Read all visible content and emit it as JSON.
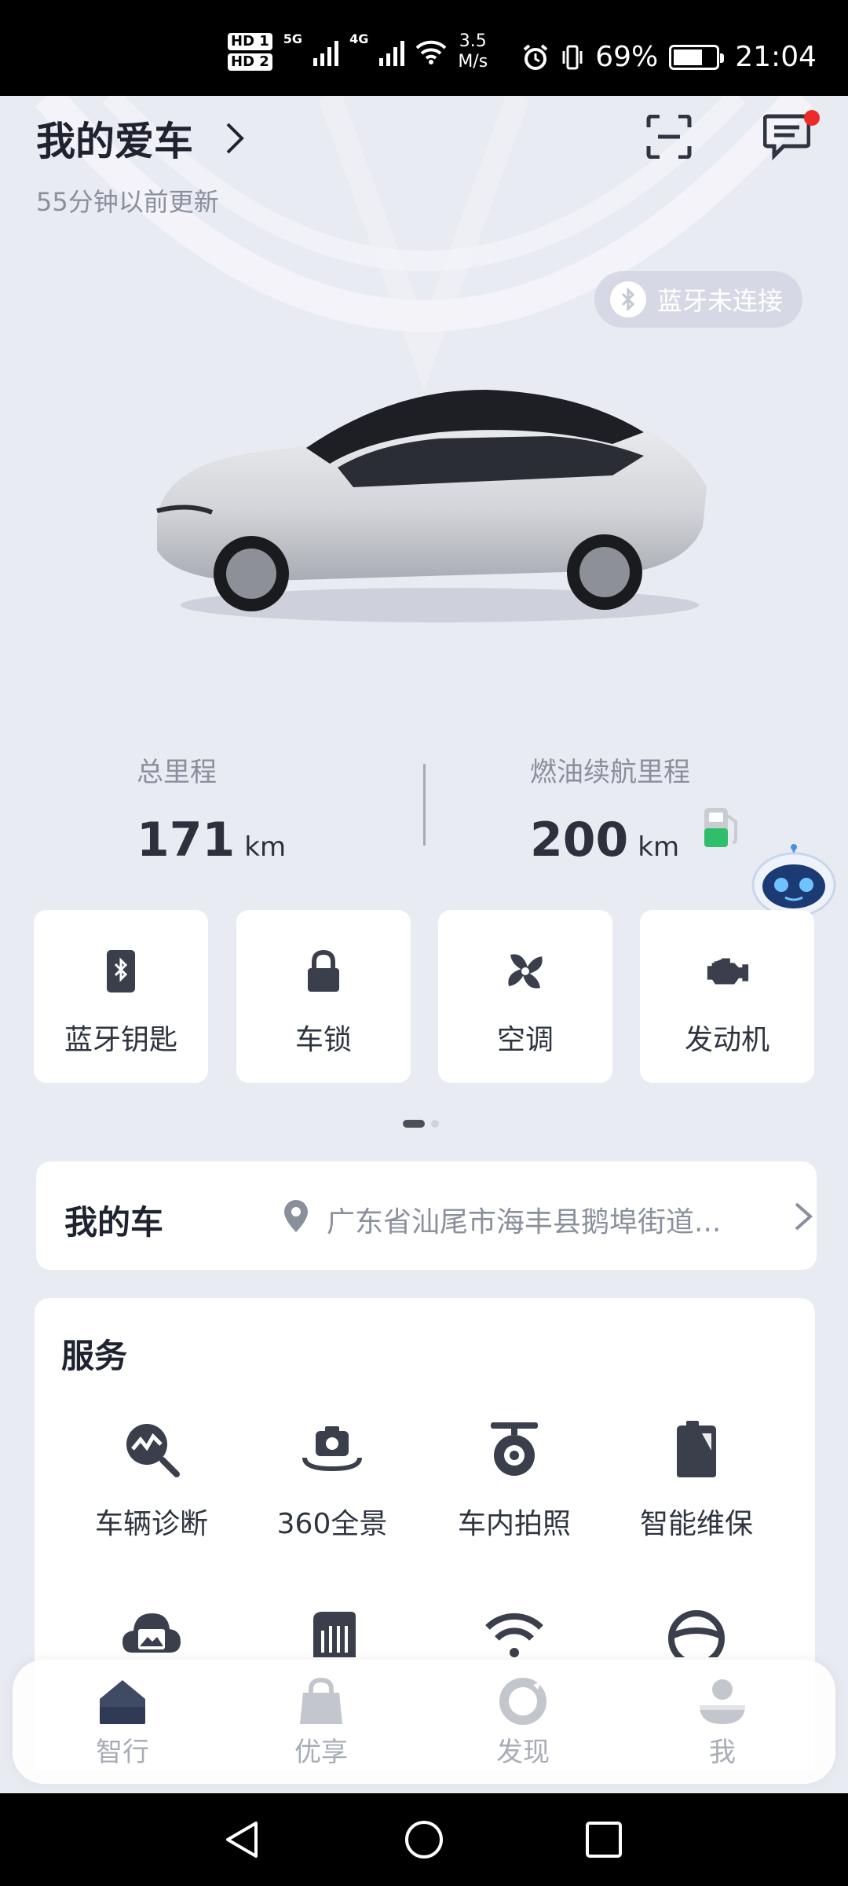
{
  "status_bar": {
    "hd1": "HD 1",
    "hd2": "HD 2",
    "net1": "5G",
    "net2": "4G",
    "speed_value": "3.5",
    "speed_unit": "M/s",
    "battery_percent": "69%",
    "battery_level": 0.69,
    "time": "21:04"
  },
  "header": {
    "title": "我的爱车",
    "subtitle": "55分钟以前更新",
    "bluetooth_status": "蓝牙未连接"
  },
  "stats": {
    "total_mileage_label": "总里程",
    "total_mileage_value": "171",
    "total_mileage_unit": "km",
    "fuel_range_label": "燃油续航里程",
    "fuel_range_value": "200",
    "fuel_range_unit": "km"
  },
  "quick_actions": [
    {
      "label": "蓝牙钥匙",
      "icon": "bluetooth-key-icon"
    },
    {
      "label": "车锁",
      "icon": "lock-icon"
    },
    {
      "label": "空调",
      "icon": "fan-icon"
    },
    {
      "label": "发动机",
      "icon": "engine-icon"
    }
  ],
  "location": {
    "title": "我的车",
    "address": "广东省汕尾市海丰县鹅埠街道..."
  },
  "services": {
    "title": "服务",
    "items": [
      {
        "label": "车辆诊断",
        "icon": "diagnosis-icon"
      },
      {
        "label": "360全景",
        "icon": "panorama-camera-icon"
      },
      {
        "label": "车内拍照",
        "icon": "in-car-camera-icon"
      },
      {
        "label": "智能维保",
        "icon": "maintenance-icon"
      },
      {
        "label": "",
        "icon": "cloud-photo-icon"
      },
      {
        "label": "",
        "icon": "dashcam-icon"
      },
      {
        "label": "",
        "icon": "wifi-icon"
      },
      {
        "label": "",
        "icon": "steering-wheel-icon"
      }
    ]
  },
  "bottom_nav": [
    {
      "label": "智行",
      "icon": "home-icon",
      "active": true
    },
    {
      "label": "优享",
      "icon": "shopping-bag-icon",
      "active": false
    },
    {
      "label": "发现",
      "icon": "discover-icon",
      "active": false
    },
    {
      "label": "我",
      "icon": "profile-icon",
      "active": false
    }
  ],
  "colors": {
    "accent_dark": "#3a3f4b",
    "fuel_green": "#2fbf6a",
    "badge_red": "#ee2b2b",
    "nav_grey": "#a8acb6"
  }
}
